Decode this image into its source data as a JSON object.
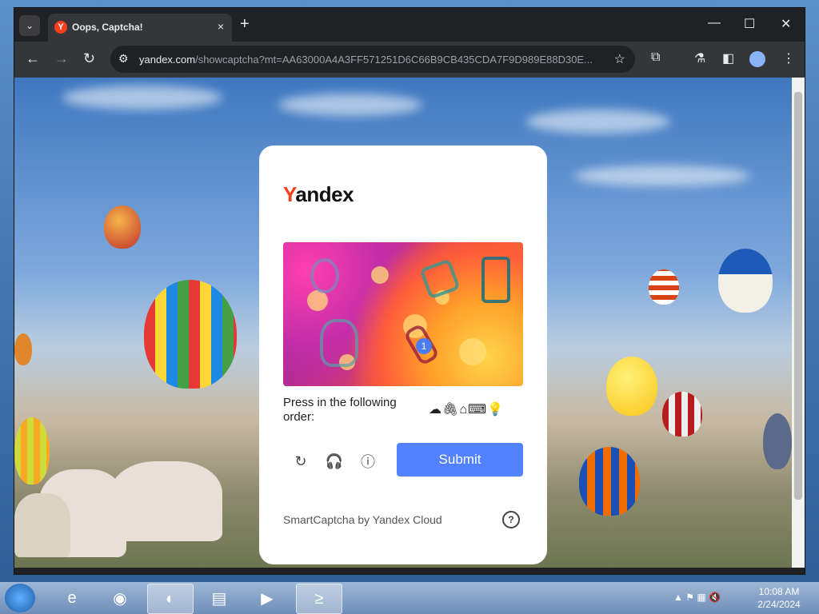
{
  "browser": {
    "tab_title": "Oops, Captcha!",
    "tab_favicon": "Y",
    "url_host": "yandex.com",
    "url_path": "/showcaptcha?mt=AA63000A4A3FF571251D6C66B9CB435CDA7F9D989E88D30E...",
    "new_tab_label": "+",
    "tab_close": "×"
  },
  "captcha": {
    "logo_first": "Y",
    "logo_rest": "andex",
    "instruction": "Press in the following order:",
    "order_icons": "☁🖇⌂⌨💡",
    "badge": "1",
    "submit_label": "Submit",
    "footer": "SmartCaptcha by Yandex Cloud",
    "help": "?"
  },
  "taskbar": {
    "time": "10:08 AM",
    "date": "2/24/2024"
  },
  "colors": {
    "brand_red": "#fc3f1d",
    "submit_blue": "#5282ff"
  }
}
